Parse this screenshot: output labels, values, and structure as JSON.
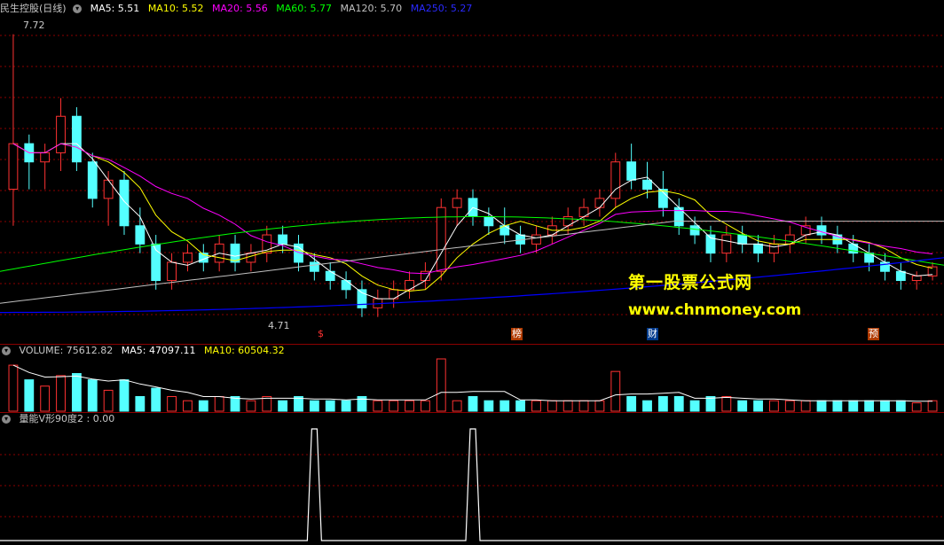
{
  "main_header": {
    "title": "民生控股(日线)",
    "ma5": "MA5: 5.51",
    "ma10": "MA10: 5.52",
    "ma20": "MA20: 5.56",
    "ma60": "MA60: 5.77",
    "ma120": "MA120: 5.70",
    "ma250": "MA250: 5.27",
    "colors": {
      "ma5": "#ffffff",
      "ma10": "#ffff00",
      "ma20": "#ff00ff",
      "ma60": "#00ff00",
      "ma120": "#c0c0c0",
      "ma250": "#0000ff"
    }
  },
  "price_labels": {
    "high": "7.72",
    "low": "4.71"
  },
  "events": [
    "$",
    "榜",
    "财",
    "预"
  ],
  "watermark": {
    "line1": "第一股票公式网",
    "line2": "www.chnmoney.com"
  },
  "volume_header": {
    "label": "VOLUME: 75612.82",
    "ma5": "MA5: 47097.11",
    "ma10": "MA10: 60504.32"
  },
  "indicator_header": {
    "label": "量能V形90度2 : 0.00"
  },
  "colors": {
    "up": "#ff3232",
    "down": "#54ffff",
    "grid": "#8b0000",
    "text": "#c8c8c8"
  },
  "chart_data": {
    "type": "candlestick",
    "ylim": [
      4.5,
      7.9
    ],
    "candles": [
      [
        6.0,
        7.7,
        5.6,
        6.5
      ],
      [
        6.5,
        6.6,
        6.0,
        6.3
      ],
      [
        6.3,
        6.5,
        6.0,
        6.4
      ],
      [
        6.4,
        7.0,
        6.2,
        6.8
      ],
      [
        6.8,
        6.9,
        6.2,
        6.3
      ],
      [
        6.3,
        6.4,
        5.8,
        5.9
      ],
      [
        5.9,
        6.2,
        5.6,
        6.1
      ],
      [
        6.1,
        6.2,
        5.5,
        5.6
      ],
      [
        5.6,
        5.8,
        5.3,
        5.4
      ],
      [
        5.4,
        5.5,
        4.9,
        5.0
      ],
      [
        5.0,
        5.3,
        4.9,
        5.2
      ],
      [
        5.2,
        5.4,
        5.1,
        5.3
      ],
      [
        5.3,
        5.4,
        5.1,
        5.2
      ],
      [
        5.2,
        5.5,
        5.1,
        5.4
      ],
      [
        5.4,
        5.5,
        5.1,
        5.2
      ],
      [
        5.2,
        5.4,
        5.1,
        5.3
      ],
      [
        5.3,
        5.6,
        5.2,
        5.5
      ],
      [
        5.5,
        5.6,
        5.3,
        5.4
      ],
      [
        5.4,
        5.5,
        5.1,
        5.2
      ],
      [
        5.2,
        5.3,
        5.0,
        5.1
      ],
      [
        5.1,
        5.2,
        4.9,
        5.0
      ],
      [
        5.0,
        5.1,
        4.8,
        4.9
      ],
      [
        4.9,
        5.0,
        4.6,
        4.7
      ],
      [
        4.7,
        4.9,
        4.6,
        4.8
      ],
      [
        4.8,
        5.0,
        4.7,
        4.9
      ],
      [
        4.9,
        5.1,
        4.8,
        5.0
      ],
      [
        5.0,
        5.2,
        4.9,
        5.1
      ],
      [
        5.1,
        5.9,
        5.0,
        5.8
      ],
      [
        5.8,
        6.0,
        5.6,
        5.9
      ],
      [
        5.9,
        6.0,
        5.6,
        5.7
      ],
      [
        5.7,
        5.8,
        5.5,
        5.6
      ],
      [
        5.6,
        5.8,
        5.4,
        5.5
      ],
      [
        5.5,
        5.6,
        5.3,
        5.4
      ],
      [
        5.4,
        5.6,
        5.3,
        5.5
      ],
      [
        5.5,
        5.7,
        5.4,
        5.6
      ],
      [
        5.6,
        5.8,
        5.5,
        5.7
      ],
      [
        5.7,
        5.9,
        5.6,
        5.8
      ],
      [
        5.8,
        6.0,
        5.7,
        5.9
      ],
      [
        5.9,
        6.4,
        5.8,
        6.3
      ],
      [
        6.3,
        6.5,
        6.0,
        6.1
      ],
      [
        6.1,
        6.3,
        5.9,
        6.0
      ],
      [
        6.0,
        6.2,
        5.7,
        5.8
      ],
      [
        5.8,
        5.9,
        5.5,
        5.6
      ],
      [
        5.6,
        5.7,
        5.4,
        5.5
      ],
      [
        5.5,
        5.6,
        5.2,
        5.3
      ],
      [
        5.3,
        5.6,
        5.2,
        5.5
      ],
      [
        5.5,
        5.6,
        5.3,
        5.4
      ],
      [
        5.4,
        5.5,
        5.2,
        5.3
      ],
      [
        5.3,
        5.5,
        5.2,
        5.4
      ],
      [
        5.4,
        5.6,
        5.3,
        5.5
      ],
      [
        5.5,
        5.7,
        5.4,
        5.6
      ],
      [
        5.6,
        5.7,
        5.4,
        5.5
      ],
      [
        5.5,
        5.6,
        5.3,
        5.4
      ],
      [
        5.4,
        5.5,
        5.2,
        5.3
      ],
      [
        5.3,
        5.4,
        5.1,
        5.2
      ],
      [
        5.2,
        5.3,
        5.0,
        5.1
      ],
      [
        5.1,
        5.2,
        4.9,
        5.0
      ],
      [
        5.0,
        5.1,
        4.9,
        5.05
      ],
      [
        5.05,
        5.2,
        5.0,
        5.15
      ]
    ],
    "volume_ylim": [
      0,
      20
    ]
  }
}
